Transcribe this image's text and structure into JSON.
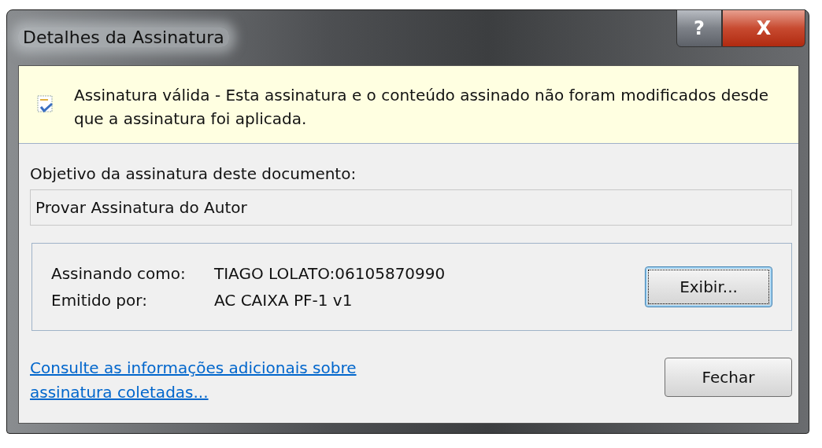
{
  "window": {
    "title": "Detalhes da Assinatura",
    "title_buttons": [
      {
        "kind": "help",
        "label": "?"
      },
      {
        "kind": "close",
        "label": "X"
      }
    ]
  },
  "banner": {
    "text": "Assinatura válida - Esta assinatura e o conteúdo assinado não foram modificados desde que a assinatura foi aplicada."
  },
  "purpose": {
    "label": "Objetivo da assinatura deste documento:",
    "value": "Provar Assinatura do Autor"
  },
  "signer": {
    "rows": [
      {
        "label": "Assinando como:",
        "value": "TIAGO LOLATO:06105870990"
      },
      {
        "label": "Emitido por:",
        "value": "AC CAIXA PF-1 v1"
      }
    ],
    "button": {
      "label": "Exibir...",
      "focused": true
    }
  },
  "link": "Consulte as informações adicionais sobre assinatura coletadas...",
  "close_button": {
    "label": "Fechar",
    "focused": false
  }
}
